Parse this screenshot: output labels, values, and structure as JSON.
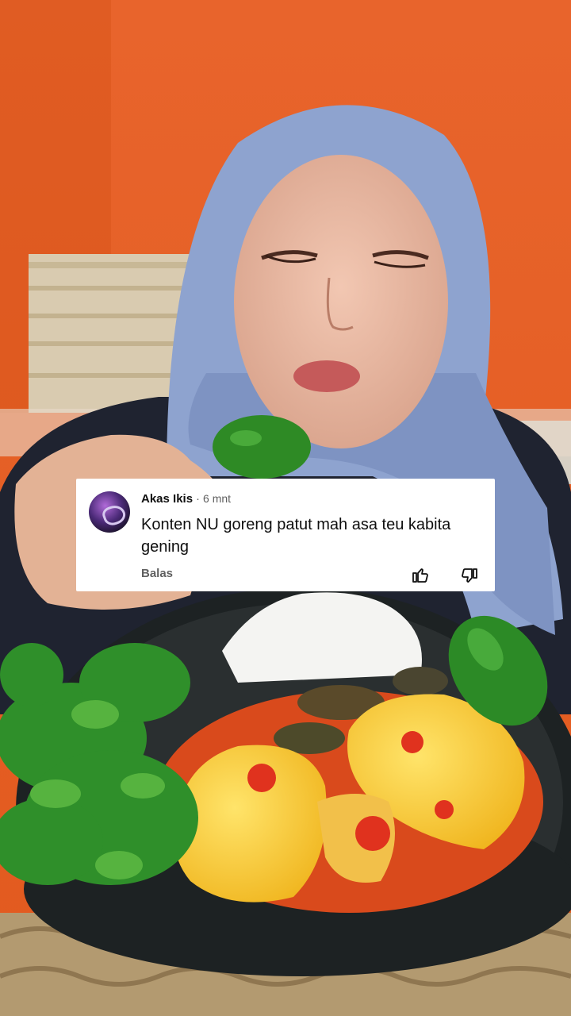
{
  "comment": {
    "author": "Akas Ikis",
    "separator": "·",
    "time": "6 mnt",
    "text": "Konten NU goreng patut mah asa teu kabita gening",
    "reply_label": "Balas",
    "like_icon": "thumbs-up-icon",
    "dislike_icon": "thumbs-down-icon"
  },
  "colors": {
    "background_wall": "#e8622a",
    "card": "#ffffff",
    "text_primary": "#0f0f0f",
    "text_secondary": "#606060"
  }
}
